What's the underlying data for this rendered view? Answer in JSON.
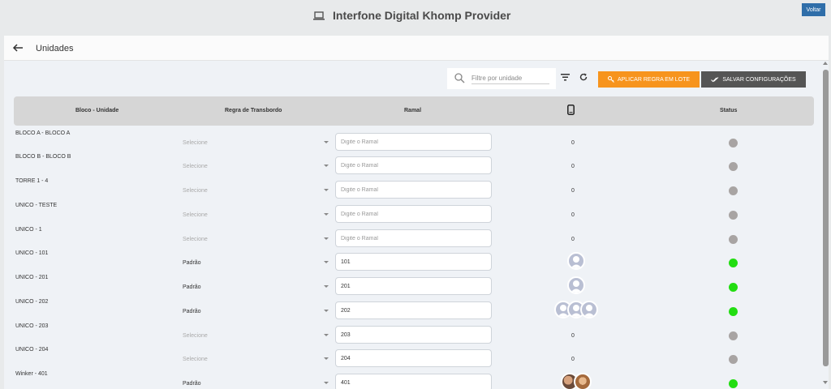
{
  "app": {
    "title": "Interfone Digital Khomp Provider",
    "back_button": "Voltar"
  },
  "page": {
    "title": "Unidades"
  },
  "toolbar": {
    "search_placeholder": "Filtre por unidade",
    "apply_button": "APLICAR REGRA EM LOTE",
    "save_button": "SALVAR CONFIGURAÇÕES"
  },
  "table": {
    "columns": [
      "Bloco - Unidade",
      "Regra de Transbordo",
      "Ramal",
      "phone-icon",
      "Status"
    ],
    "rows": [
      {
        "unit": "BLOCO A - BLOCO A",
        "regra": "Selecione",
        "regra_set": false,
        "ramal": "",
        "ramal_placeholder": "Digite o Ramal",
        "count": "0",
        "avatars": [],
        "status": "offline"
      },
      {
        "unit": "BLOCO B - BLOCO B",
        "regra": "Selecione",
        "regra_set": false,
        "ramal": "",
        "ramal_placeholder": "Digite o Ramal",
        "count": "0",
        "avatars": [],
        "status": "offline"
      },
      {
        "unit": "TORRE 1 - 4",
        "regra": "Selecione",
        "regra_set": false,
        "ramal": "",
        "ramal_placeholder": "Digite o Ramal",
        "count": "0",
        "avatars": [],
        "status": "offline"
      },
      {
        "unit": "UNICO - TESTE",
        "regra": "Selecione",
        "regra_set": false,
        "ramal": "",
        "ramal_placeholder": "Digite o Ramal",
        "count": "0",
        "avatars": [],
        "status": "offline"
      },
      {
        "unit": "UNICO - 1",
        "regra": "Selecione",
        "regra_set": false,
        "ramal": "",
        "ramal_placeholder": "Digite o Ramal",
        "count": "0",
        "avatars": [],
        "status": "offline"
      },
      {
        "unit": "UNICO - 101",
        "regra": "Padrão",
        "regra_set": true,
        "ramal": "101",
        "ramal_placeholder": "Digite o Ramal",
        "count": "",
        "avatars": [
          "default"
        ],
        "status": "online"
      },
      {
        "unit": "UNICO - 201",
        "regra": "Padrão",
        "regra_set": true,
        "ramal": "201",
        "ramal_placeholder": "Digite o Ramal",
        "count": "",
        "avatars": [
          "default"
        ],
        "status": "online"
      },
      {
        "unit": "UNICO - 202",
        "regra": "Padrão",
        "regra_set": true,
        "ramal": "202",
        "ramal_placeholder": "Digite o Ramal",
        "count": "",
        "avatars": [
          "default",
          "default",
          "default"
        ],
        "status": "online"
      },
      {
        "unit": "UNICO - 203",
        "regra": "Selecione",
        "regra_set": false,
        "ramal": "203",
        "ramal_placeholder": "Digite o Ramal",
        "count": "0",
        "avatars": [],
        "status": "offline"
      },
      {
        "unit": "UNICO - 204",
        "regra": "Selecione",
        "regra_set": false,
        "ramal": "204",
        "ramal_placeholder": "Digite o Ramal",
        "count": "0",
        "avatars": [],
        "status": "offline"
      },
      {
        "unit": "Winker - 401",
        "regra": "Padrão",
        "regra_set": true,
        "ramal": "401",
        "ramal_placeholder": "Digite o Ramal",
        "count": "",
        "avatars": [
          "photo1",
          "photo2"
        ],
        "status": "online"
      }
    ]
  },
  "colors": {
    "accent_blue": "#2f6ea9",
    "orange": "#f7941d",
    "dark_button": "#555555",
    "status_online": "#22dd11",
    "status_offline": "#a8a4a3"
  }
}
